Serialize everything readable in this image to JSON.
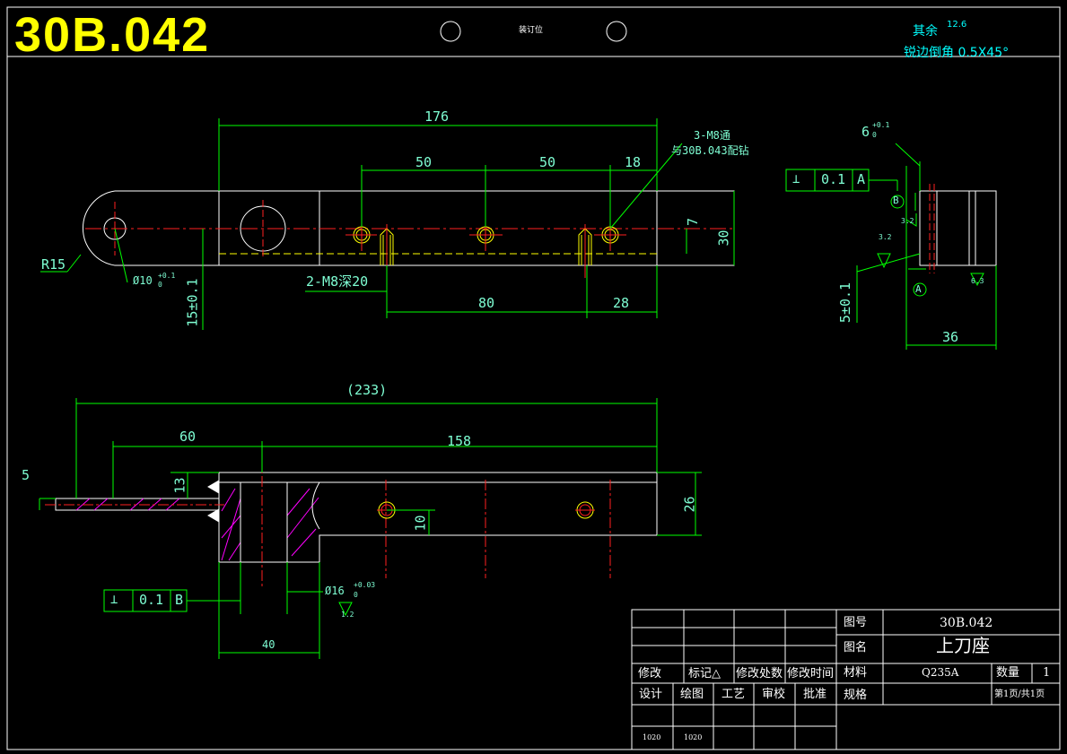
{
  "header": {
    "drawing_number": "30B.042",
    "binding_label": "装订位",
    "surface_note_label": "其余",
    "surface_note_value": "12.6",
    "chamfer_note": "锐边倒角 0.5X45°"
  },
  "front_view": {
    "dim_overall": "176",
    "dim_pitch_1": "50",
    "dim_pitch_2": "50",
    "dim_edge": "18",
    "callout_holes_line1": "3-M8通",
    "callout_holes_line2": "与30B.043配钻",
    "dim_height": "30",
    "dim_offset": "7",
    "radius_label": "R15",
    "bore_label": "Ø10",
    "bore_tol_upper": "+0.1",
    "bore_tol_lower": "0",
    "tapped_holes": "2-M8深20",
    "dim_vertical": "15±0.1",
    "dim_80": "80",
    "dim_28": "28"
  },
  "side_view": {
    "dim_slot": "6",
    "dim_slot_tol_upper": "+0.1",
    "dim_slot_tol_lower": "0",
    "perp_value": "0.1",
    "perp_datum": "A",
    "datum_b": "B",
    "datum_a": "A",
    "rough_1": "3.2",
    "rough_2": "3.2",
    "rough_3": "6.3",
    "dim_vertical": "5±0.1",
    "dim_width": "36"
  },
  "top_view": {
    "dim_overall": "(233)",
    "dim_60": "60",
    "dim_158": "158",
    "dim_5": "5",
    "dim_13": "13",
    "dim_26": "26",
    "dim_10": "10",
    "dim_40": "40",
    "bore_label": "Ø16",
    "bore_tol_upper": "+0.03",
    "bore_tol_lower": "0",
    "rough": "1.2",
    "perp_value": "0.1",
    "perp_datum": "B"
  },
  "title_block": {
    "drawing_no_label": "图号",
    "drawing_no_value": "30B.042",
    "part_name_label": "图名",
    "part_name_value": "上刀座",
    "material_label": "材料",
    "material_value": "Q235A",
    "quantity_label": "数量",
    "quantity_value": "1",
    "spec_label": "规格",
    "page_info": "第1页/共1页",
    "rev_headers": [
      "修改",
      "标记△",
      "修改处数",
      "修改时间"
    ],
    "sign_headers": [
      "设计",
      "绘图",
      "工艺",
      "审校",
      "批准"
    ],
    "dates": [
      "1020",
      "1020"
    ]
  },
  "colors": {
    "outline": "#ffffff",
    "dimension": "#00ff00",
    "text": "#7fffd4",
    "center": "#ff2020",
    "hidden": "#ffff00",
    "hatch": "#ff00ff",
    "frame": "#ffffff",
    "title": "#ffff00"
  }
}
